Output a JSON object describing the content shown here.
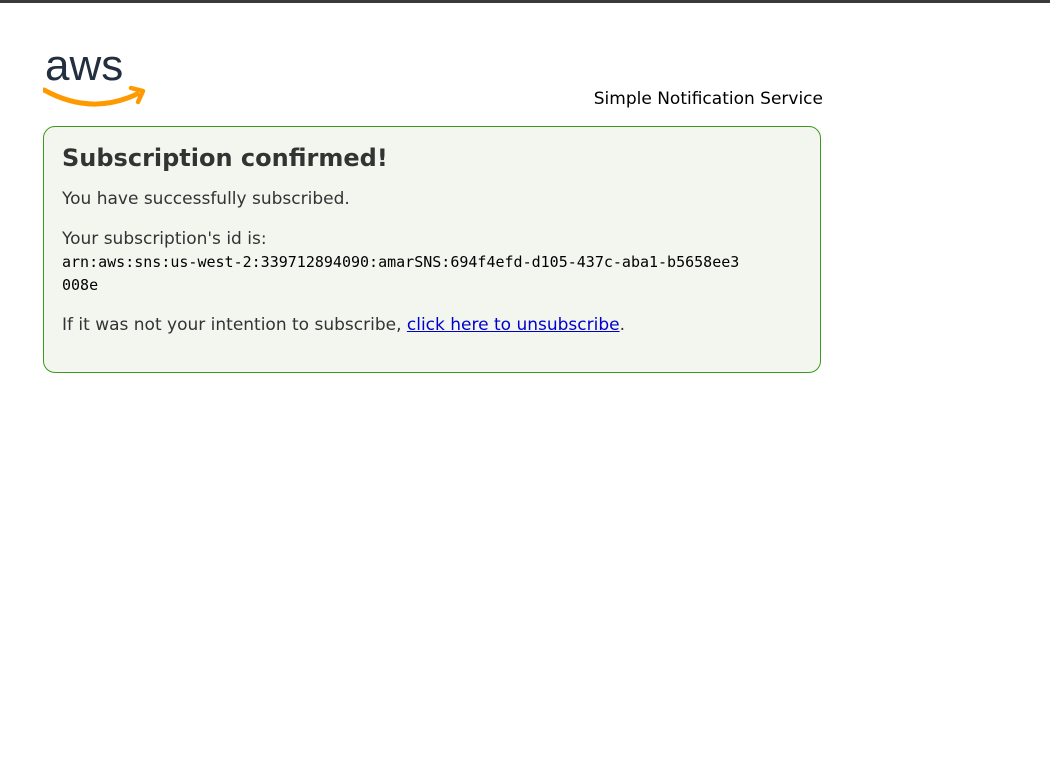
{
  "header": {
    "logo_text": "aws",
    "service_name": "Simple Notification Service"
  },
  "panel": {
    "title": "Subscription confirmed!",
    "message": "You have successfully subscribed.",
    "id_label": "Your subscription's id is:",
    "subscription_arn": "arn:aws:sns:us-west-2:339712894090:amarSNS:694f4efd-d105-437c-aba1-b5658ee3008e",
    "unsubscribe_prefix": "If it was not your intention to subscribe, ",
    "unsubscribe_link": "click here to unsubscribe",
    "unsubscribe_suffix": "."
  },
  "colors": {
    "panel_border": "#3d9a1f",
    "panel_background": "#f2f6ef",
    "logo_text": "#232f3e",
    "logo_smile": "#ff9900",
    "link": "#0000cc"
  }
}
